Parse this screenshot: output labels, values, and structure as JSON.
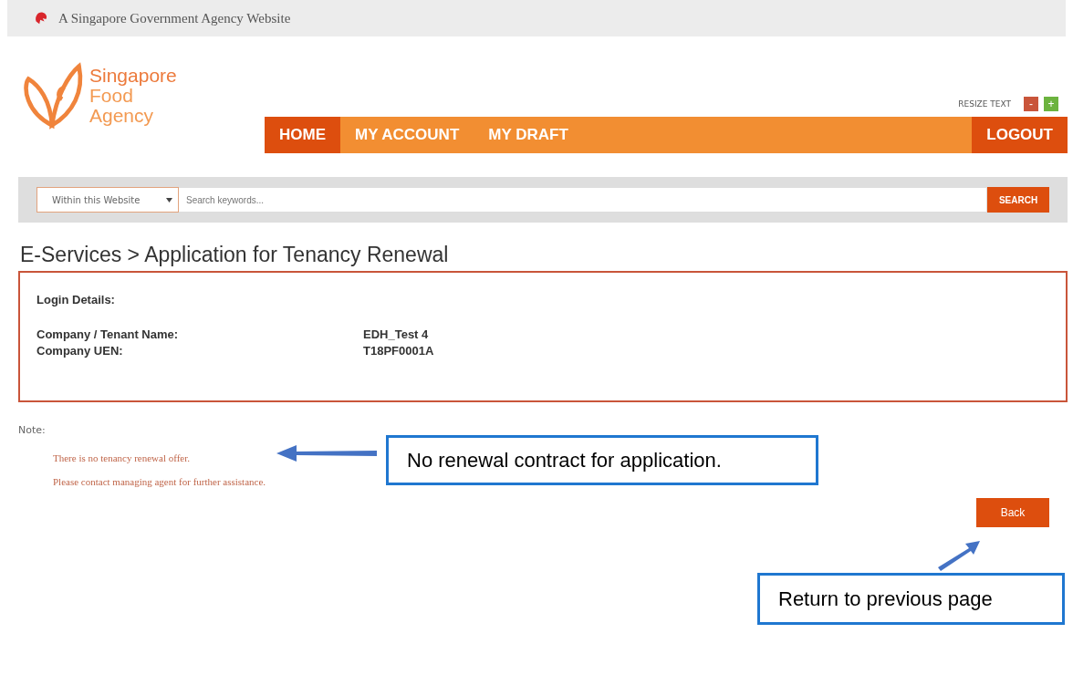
{
  "gov_banner": {
    "text": "A Singapore Government Agency Website"
  },
  "logo": {
    "lines": [
      "Singapore",
      "Food",
      "Agency"
    ]
  },
  "resize_text": {
    "label": "RESIZE TEXT",
    "decrease": "-",
    "increase": "+"
  },
  "nav": {
    "items": [
      {
        "label": "HOME",
        "selected": true
      },
      {
        "label": "MY ACCOUNT",
        "selected": false
      },
      {
        "label": "MY DRAFT",
        "selected": false
      }
    ],
    "logout": "LOGOUT"
  },
  "search": {
    "scope": "Within this Website",
    "placeholder": "Search keywords...",
    "button": "SEARCH"
  },
  "heading": "E-Services > Application for Tenancy Renewal",
  "login_details": {
    "title": "Login Details:",
    "fields": [
      {
        "label": "Company / Tenant Name:",
        "value": "EDH_Test 4"
      },
      {
        "label": "Company UEN:",
        "value": "T18PF0001A"
      }
    ]
  },
  "note": {
    "label": "Note:",
    "lines": [
      "There is no tenancy renewal offer.",
      "Please contact managing agent for further assistance."
    ]
  },
  "back_button": "Back",
  "annotations": [
    {
      "text": "No renewal contract for application."
    },
    {
      "text": "Return to previous page"
    }
  ]
}
